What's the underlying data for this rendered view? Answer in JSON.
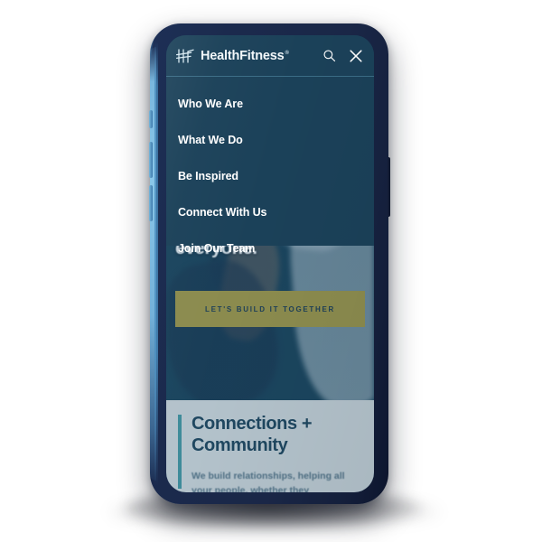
{
  "device": {
    "type": "smartphone-mockup",
    "orientation": "portrait"
  },
  "header": {
    "logo_word": "HealthFitness",
    "logo_trademark": "®",
    "logo_icon": "hf-monogram-icon",
    "search_icon": "search-icon",
    "close_icon": "close-icon",
    "search_label": "Search",
    "close_label": "Close menu"
  },
  "menu": {
    "items": [
      {
        "label": "Who We Are"
      },
      {
        "label": "What We Do"
      },
      {
        "label": "Be Inspired"
      },
      {
        "label": "Connect With Us"
      },
      {
        "label": "Join Our Team"
      }
    ]
  },
  "hero": {
    "headline_fragment": "everyone.",
    "cta_label": "LET'S BUILD IT TOGETHER"
  },
  "content_card": {
    "title": "Connections + Community",
    "body": "We build relationships, helping all your people, whether they"
  },
  "colors": {
    "menu_panel": "#1b4159",
    "screen_base": "#18435c",
    "cta_background": "#8b8b4e",
    "cta_text": "#1d3f58",
    "card_background": "#b3c2cb",
    "card_title": "#1f4760",
    "card_body": "#4e6f84",
    "accent_bar": "#3e8b9a",
    "divider": "#3a6c85",
    "menu_text": "#ffffff",
    "phone_bezel": "#1b2a4d",
    "phone_edge_highlight": "#8ac7e9",
    "page_background": "#ffffff"
  }
}
